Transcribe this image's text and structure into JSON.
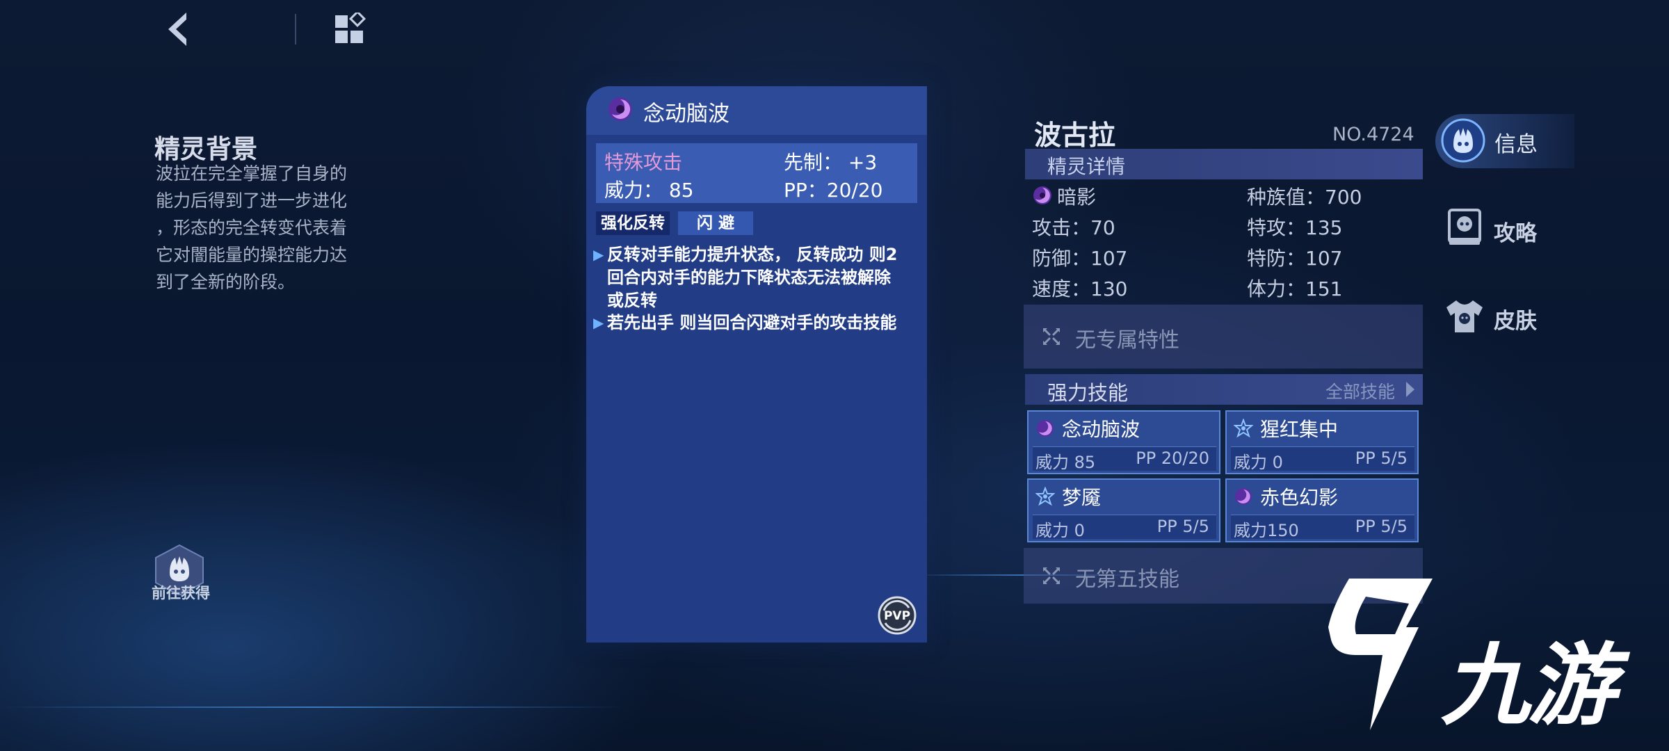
{
  "background": {
    "title": "精灵背景",
    "lines": [
      "波拉在完全掌握了自身的",
      "能力后得到了进一步进化",
      "，形态的完全转变代表着",
      "它对闇能量的操控能力达",
      "到了全新的阶段。"
    ]
  },
  "get_button": {
    "label": "前往获得"
  },
  "skill_card": {
    "name": "念动脑波",
    "category": "特殊攻击",
    "priority": "先制： +3",
    "power": "威力：  85",
    "pp": "PP：20/20",
    "tags": [
      "强化反转",
      "闪 避"
    ],
    "effects": [
      "反转对手能力提升状态，  反转成功 则2回合内对手的能力下降状态无法被解除或反转",
      "若先出手 则当回合闪避对手的攻击技能"
    ],
    "pvp_label": "PVP"
  },
  "pet": {
    "name": "波古拉",
    "number": "NO.4724",
    "detail_label": "精灵详情",
    "type": "暗影",
    "total": "种族值：700",
    "atk": "攻击：70",
    "satk": "特攻：135",
    "def": "防御：107",
    "sdef": "特防：107",
    "spd": "速度：130",
    "hp": "体力：151",
    "trait": "无专属特性",
    "strong_skills_label": "强力技能",
    "all_skills_label": "全部技能",
    "skills": [
      {
        "name": "念动脑波",
        "power": "威力 85",
        "pp": "PP  20/20",
        "icon": "dark-swirl-icon"
      },
      {
        "name": "猩红集中",
        "power": "威力  0",
        "pp": "PP    5/5",
        "icon": "star-icon"
      },
      {
        "name": "梦魇",
        "power": "威力  0",
        "pp": "PP    5/5",
        "icon": "star-icon"
      },
      {
        "name": "赤色幻影",
        "power": "威力150",
        "pp": "PP    5/5",
        "icon": "dark-swirl-icon"
      }
    ],
    "fifth_skill": "无第五技能"
  },
  "side_tabs": {
    "info": "信息",
    "guide": "攻略",
    "skin": "皮肤"
  },
  "watermark": {
    "text": "九游"
  },
  "colors": {
    "card_bg": "#223d86",
    "category_pink": "#e39ad9",
    "accent_blue": "#5a86d2"
  }
}
